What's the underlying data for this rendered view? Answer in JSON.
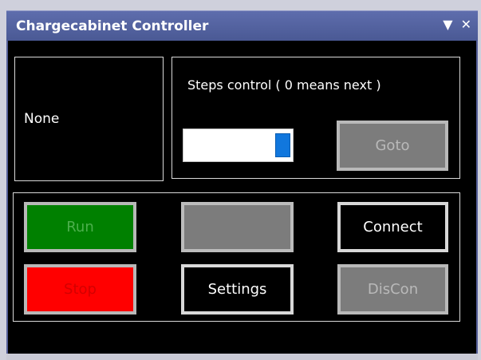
{
  "window": {
    "title": "Chargecabinet Controller",
    "menu_icon": "dropdown-arrow-icon",
    "menu_glyph": "▼",
    "close_icon": "close-icon",
    "close_glyph": "✕"
  },
  "status": {
    "text": "None"
  },
  "steps": {
    "label": "Steps control ( 0 means next )",
    "value": "",
    "goto_label": "Goto"
  },
  "controls": {
    "run_label": "Run",
    "blank_label": "",
    "connect_label": "Connect",
    "stop_label": "Stop",
    "settings_label": "Settings",
    "discon_label": "DisCon"
  },
  "colors": {
    "titlebar": "#4a5994",
    "panel": "#000000",
    "run": "#008000",
    "stop": "#ff0000",
    "disabled": "#7c7c7c",
    "slider_thumb": "#1177dd"
  }
}
